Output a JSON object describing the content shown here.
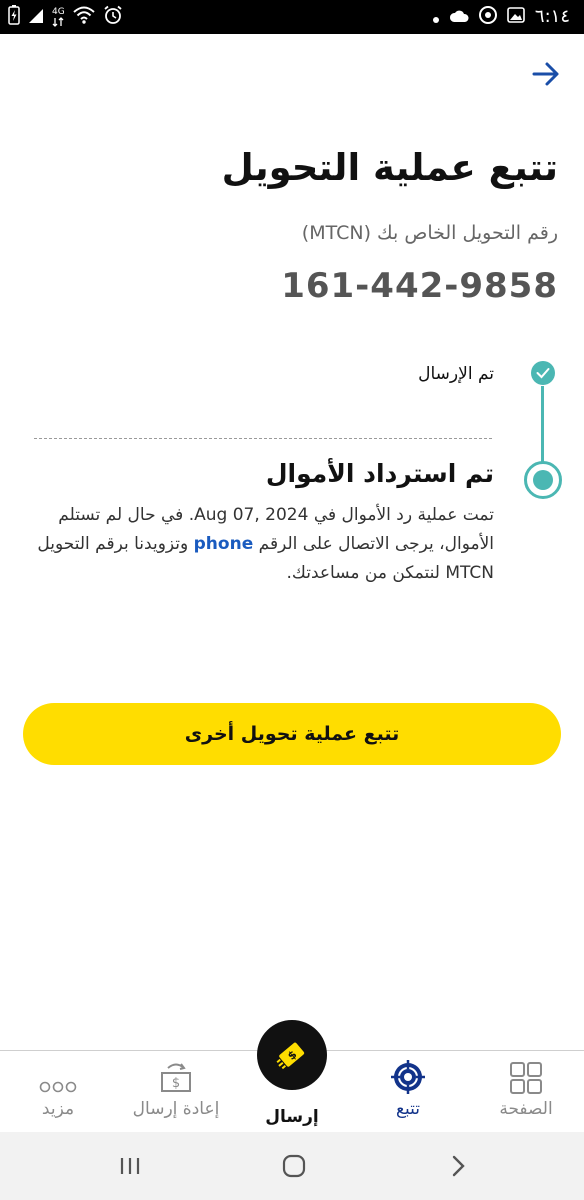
{
  "status_bar": {
    "time": "٦:١٤",
    "network": "4G"
  },
  "header": {
    "back_icon": "arrow-right-icon"
  },
  "page": {
    "title": "تتبع عملية التحويل",
    "mtcn_label": "رقم التحويل الخاص بك (MTCN)",
    "mtcn_value": "161-442-9858"
  },
  "timeline": {
    "step1": {
      "label": "تم الإرسال",
      "status": "completed"
    },
    "step2": {
      "title": "تم استرداد الأموال",
      "desc_part1": "تمت عملية رد الأموال في ",
      "date": "Aug 07, 2024",
      "desc_part2": ". في حال لم تستلم الأموال، يرجى الاتصال على الرقم ",
      "phone_link": "phone",
      "desc_part3": " وتزويدنا برقم التحويل MTCN لنتمكن من مساعدتك.",
      "status": "current"
    }
  },
  "primary_button": {
    "label": "تتبع عملية تحويل أخرى"
  },
  "bottom_nav": {
    "items": [
      {
        "label": "الصفحة",
        "icon": "grid-icon"
      },
      {
        "label": "إعادة إرسال",
        "icon": "resend-money-icon"
      },
      {
        "label": "إرسال",
        "icon": "send-money-icon"
      },
      {
        "label": "تتبع",
        "icon": "target-icon"
      },
      {
        "label": "مزيد",
        "icon": "more-dots-icon"
      }
    ],
    "active": "تتبع"
  },
  "colors": {
    "accent_yellow": "#ffdd00",
    "timeline_teal": "#4bb7b3",
    "link_blue": "#1a5bbf",
    "nav_active": "#12338a"
  }
}
